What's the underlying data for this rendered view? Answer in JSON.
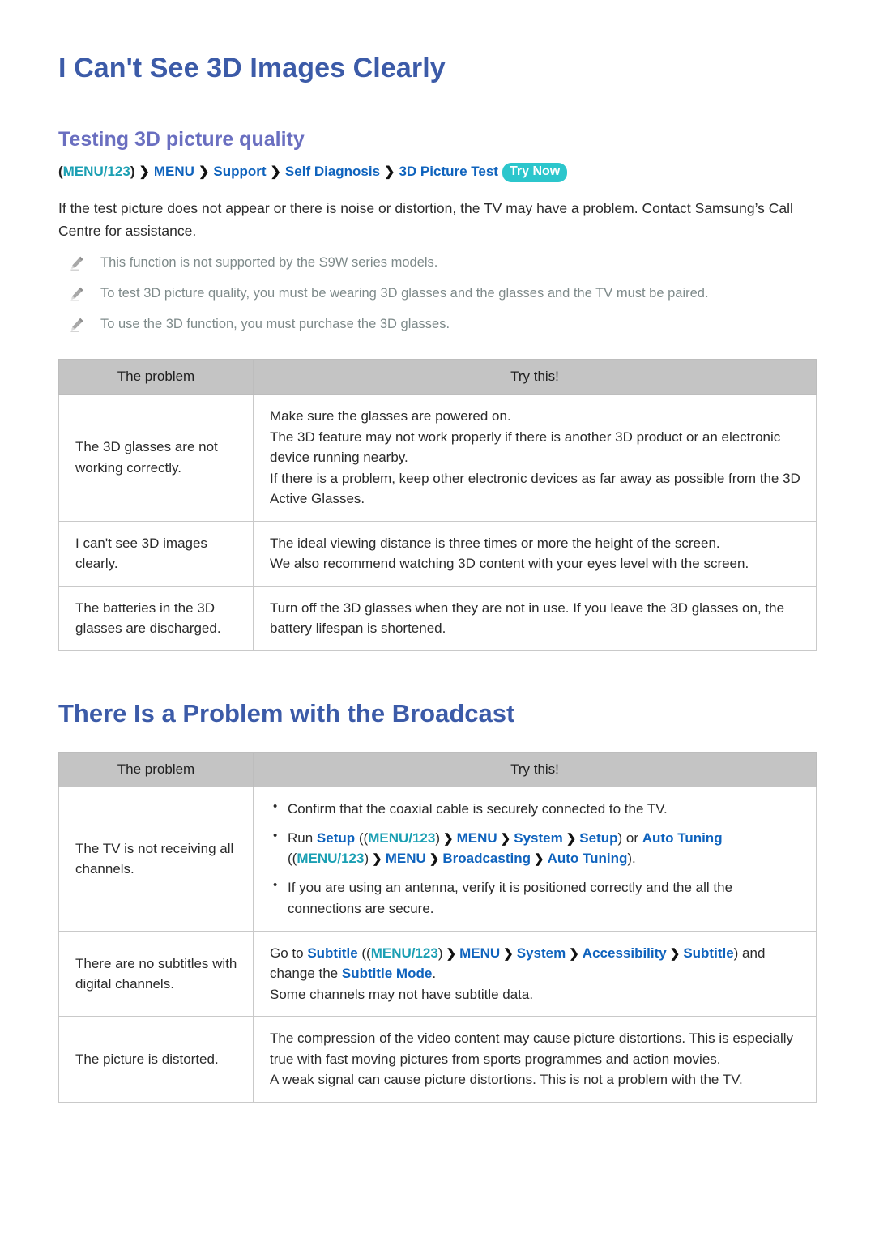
{
  "page": {
    "title": "I Can't See 3D Images Clearly",
    "subsection_title": "Testing 3D picture quality",
    "second_title": "There Is a Problem with the Broadcast"
  },
  "breadcrumb": {
    "open_paren": "(",
    "menu123": "MENU/123",
    "close_paren": ")",
    "arrow": "❯",
    "items": [
      "MENU",
      "Support",
      "Self Diagnosis",
      "3D Picture Test"
    ],
    "try_now": "Try Now"
  },
  "intro": {
    "paragraph": "If the test picture does not appear or there is noise or distortion, the TV may have a problem. Contact Samsung’s Call Centre for assistance."
  },
  "notes": [
    {
      "icon": "pencil-icon",
      "text": "This function is not supported by the S9W series models."
    },
    {
      "icon": "pencil-icon",
      "text": "To test 3D picture quality, you must be wearing 3D glasses and the glasses and the TV must be paired."
    },
    {
      "icon": "pencil-icon",
      "text": "To use the 3D function, you must purchase the 3D glasses."
    }
  ],
  "table1": {
    "headers": {
      "problem": "The problem",
      "try": "Try this!"
    },
    "rows": [
      {
        "problem": "The 3D glasses are not working correctly.",
        "lines": [
          "Make sure the glasses are powered on.",
          "The 3D feature may not work properly if there is another 3D product or an electronic device running nearby.",
          "If there is a problem, keep other electronic devices as far away as possible from the 3D Active Glasses."
        ]
      },
      {
        "problem": "I can't see 3D images clearly.",
        "lines": [
          "The ideal viewing distance is three times or more the height of the screen.",
          "We also recommend watching 3D content with your eyes level with the screen."
        ]
      },
      {
        "problem": "The batteries in the 3D glasses are discharged.",
        "lines": [
          "Turn off the 3D glasses when they are not in use. If you leave the 3D glasses on, the battery lifespan is shortened."
        ]
      }
    ]
  },
  "table2": {
    "headers": {
      "problem": "The problem",
      "try": "Try this!"
    },
    "row1": {
      "problem": "The TV is not receiving all channels.",
      "bullet1": "Confirm that the coaxial cable is securely connected to the TV.",
      "bullet2": {
        "run": "Run ",
        "setup_label": "Setup",
        "open": " ((",
        "menu123": "MENU/123",
        "close_paren": ")",
        "arrow": "❯",
        "path_a": [
          "MENU",
          "System",
          "Setup"
        ],
        "after_a": ") or ",
        "auto_tuning_label": "Auto Tuning",
        "open_b": " ((",
        "path_b": [
          "MENU",
          "Broadcasting",
          "Auto Tuning"
        ],
        "after_b": ")."
      },
      "bullet3": "If you are using an antenna, verify it is positioned correctly and the all the connections are secure."
    },
    "row2": {
      "problem": "There are no subtitles with digital channels.",
      "goto": "Go to ",
      "subtitle_label": "Subtitle",
      "open": " ((",
      "menu123": "MENU/123",
      "close_paren": ")",
      "arrow": "❯",
      "path": [
        "MENU",
        "System",
        "Accessibility",
        "Subtitle"
      ],
      "after": ") and change the ",
      "subtitle_mode_label": "Subtitle Mode",
      "after2": ".",
      "line2": "Some channels may not have subtitle data."
    },
    "row3": {
      "problem": "The picture is distorted.",
      "lines": [
        "The compression of the video content may cause picture distortions. This is especially true with fast moving pictures from sports programmes and action movies.",
        "A weak signal can cause picture distortions. This is not a problem with the TV."
      ]
    }
  },
  "colors": {
    "title_blue": "#3c5ba8",
    "subheading_purple": "#6a6fc0",
    "menu_teal": "#1b9fb3",
    "menu_blue": "#0f63bd",
    "try_now_bg": "#2cc6cc",
    "table_header_bg": "#c4c4c4",
    "note_gray": "#7e8a8a"
  }
}
